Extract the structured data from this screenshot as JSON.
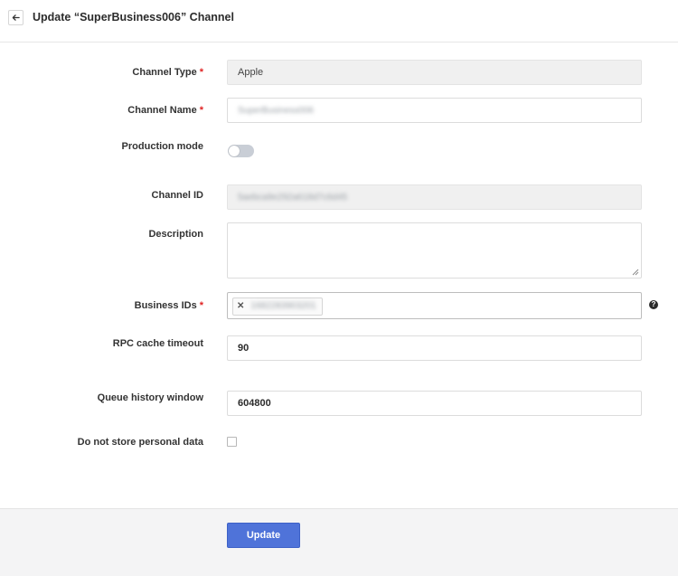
{
  "header": {
    "title": "Update “SuperBusiness006” Channel",
    "back_icon": "arrow-left-icon"
  },
  "form": {
    "channel_type": {
      "label": "Channel Type",
      "required": "*",
      "value": "Apple"
    },
    "channel_name": {
      "label": "Channel Name",
      "required": "*",
      "value": "SuperBusiness006"
    },
    "production_mode": {
      "label": "Production mode",
      "enabled": false
    },
    "channel_id": {
      "label": "Channel ID",
      "value": "5aebca9e292a618d7c6d45"
    },
    "description": {
      "label": "Description",
      "value": ""
    },
    "business_ids": {
      "label": "Business IDs",
      "required": "*",
      "tags": [
        "1682283903201"
      ],
      "help_icon": "question-circle-icon",
      "help_glyph": "?"
    },
    "rpc_cache_timeout": {
      "label": "RPC cache timeout",
      "value": "90"
    },
    "queue_history_window": {
      "label": "Queue history window",
      "value": "604800"
    },
    "do_not_store_personal_data": {
      "label": "Do not store personal data",
      "checked": false
    }
  },
  "footer": {
    "update_label": "Update",
    "accent_color": "#4f73d9"
  }
}
